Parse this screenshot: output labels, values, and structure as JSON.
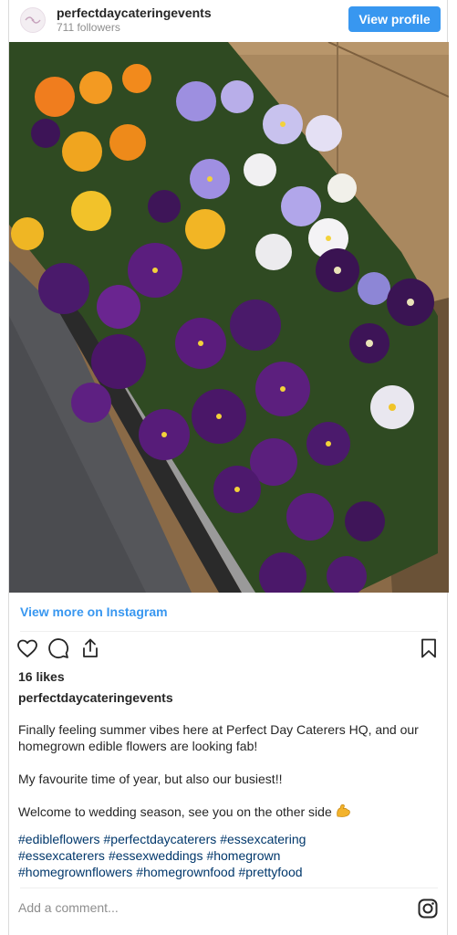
{
  "header": {
    "username": "perfectdaycateringevents",
    "followers": "711 followers",
    "view_profile_label": "View profile"
  },
  "post": {
    "image_icon": "flower-box-photo",
    "view_more_label": "View more on Instagram",
    "likes": "16 likes",
    "author": "perfectdaycateringevents",
    "caption": [
      "Finally feeling summer vibes here at Perfect Day Caterers HQ, and our homegrown edible flowers are looking fab!",
      "My favourite time of year, but also our busiest!!",
      "Welcome to wedding season, see you on the other side"
    ],
    "caption_emoji": "flexed-biceps-icon",
    "hashtags": [
      "#edibleflowers",
      "#perfectdaycaterers",
      "#essexcatering",
      "#essexcaterers",
      "#essexweddings",
      "#homegrown",
      "#homegrownflowers",
      "#homegrownfood",
      "#prettyfood"
    ]
  },
  "comment": {
    "placeholder": "Add a comment..."
  },
  "icons": [
    "heart-icon",
    "comment-icon",
    "share-icon",
    "bookmark-icon",
    "instagram-icon"
  ],
  "colors": {
    "accent": "#3897f0",
    "hashtag": "#00376b",
    "muted": "#8e8e8e"
  }
}
